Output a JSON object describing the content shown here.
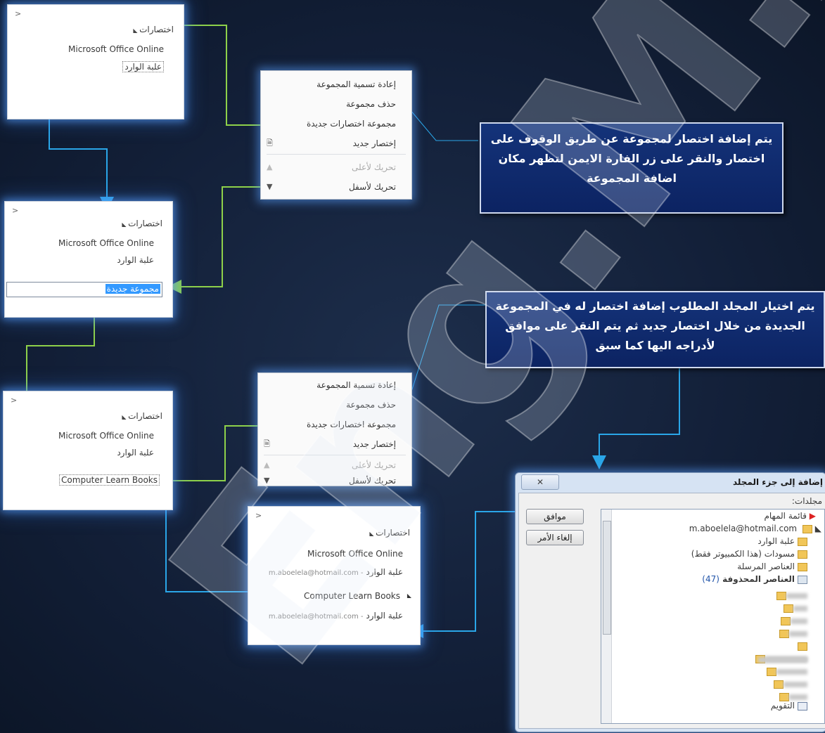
{
  "panel1": {
    "chevron": ">",
    "shortcuts_header": "اختصارات",
    "online": "Microsoft Office Online",
    "inbox": "علبة الوارد"
  },
  "menu1": {
    "rename": "إعادة تسمية المجموعة",
    "delete": "حذف مجموعة",
    "new_group": "مجموعة اختصارات جديدة",
    "new_shortcut": "إختصار جديد",
    "move_up": "تحريك لأعلى",
    "move_down": "تحريك لأسفل"
  },
  "callout1": "يتم إضافة اختصار لمجموعة عن طريق الوقوف على اختصار والنقر على زر الفارة الايمن لتظهر مكان اضافة المجموعة",
  "panel2": {
    "chevron": ">",
    "shortcuts_header": "اختصارات",
    "online": "Microsoft Office Online",
    "inbox": "علبة الوارد",
    "new_group_input": "مجموعة جديدة"
  },
  "callout2": "يتم اختيار المجلد المطلوب إضافة اختصار له في المجموعة الجديدة من خلال اختصار جديد ثم يتم النقر على موافق لأدراجه اليها كما سبق",
  "panel3": {
    "chevron": ">",
    "shortcuts_header": "اختصارات",
    "online": "Microsoft Office Online",
    "inbox": "علبة الوارد",
    "group": "Computer Learn Books"
  },
  "menu2": {
    "rename": "إعادة تسمية المجموعة",
    "delete": "حذف مجموعة",
    "new_group": "مجموعة اختصارات جديدة",
    "new_shortcut": "إختصار جديد",
    "move_up": "تحريك لأعلى",
    "move_down": "تحريك لأسفل"
  },
  "panel4": {
    "chevron": ">",
    "shortcuts_header": "اختصارات",
    "online": "Microsoft Office Online",
    "inbox": "علبة الوارد",
    "email_suffix": "- m.aboelela@hotmail.com",
    "group": "Computer Learn Books",
    "inbox2": "علبة الوارد",
    "email_suffix2": "- m.aboelela@hotmail.com"
  },
  "dialog": {
    "title": "إضافة إلى جزء المجلد",
    "close": "✕",
    "folders_label": "مجلدات:",
    "ok": "موافق",
    "cancel": "إلغاء الأمر",
    "tree": {
      "tasks": "قائمة المهام",
      "account": "m.aboelela@hotmail.com",
      "inbox": "علبة الوارد",
      "drafts": "مسودات (هذا الكمبيوتر فقط)",
      "sent": "العناصر المرسلة",
      "deleted": "العناصر المحذوفة",
      "deleted_count": "(47)",
      "calendar": "التقويم"
    }
  },
  "watermark": "Eng.M.Abu Elela",
  "colors": {
    "green_arrow": "#8ed14a",
    "blue_arrow": "#2aa6e8",
    "callout_bg": "#0f2b6e"
  }
}
